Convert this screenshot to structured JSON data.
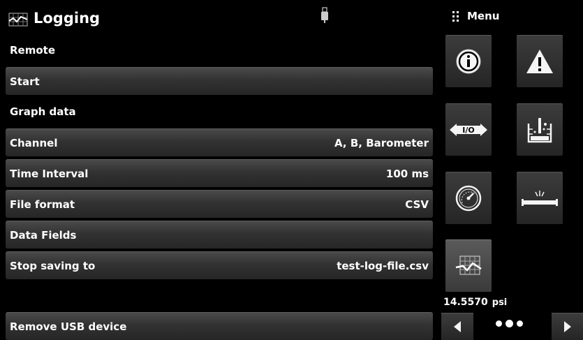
{
  "header": {
    "title": "Logging"
  },
  "rows": [
    {
      "label": "Remote",
      "value": "",
      "style": "plain"
    },
    {
      "label": "Start",
      "value": "",
      "style": "btn"
    },
    {
      "label": "Graph data",
      "value": "",
      "style": "plain"
    },
    {
      "label": "Channel",
      "value": "A, B, Barometer",
      "style": "btn"
    },
    {
      "label": "Time Interval",
      "value": "100 ms",
      "style": "btn"
    },
    {
      "label": "File format",
      "value": "CSV",
      "style": "btn"
    },
    {
      "label": "Data Fields",
      "value": "",
      "style": "btn"
    },
    {
      "label": "Stop saving to",
      "value": "test-log-file.csv",
      "style": "btn"
    },
    {
      "label": "",
      "value": "",
      "style": "plain"
    },
    {
      "label": "Remove USB device",
      "value": "",
      "style": "btn"
    }
  ],
  "menu": {
    "title": "Menu",
    "tiles": [
      {
        "icon": "info-icon"
      },
      {
        "icon": "warning-icon"
      },
      {
        "icon": "io-icon"
      },
      {
        "icon": "lab-icon"
      },
      {
        "icon": "gauge-icon"
      },
      {
        "icon": "leak-icon"
      },
      {
        "icon": "logging-icon",
        "active": true
      }
    ]
  },
  "readout": {
    "value": "14.5570",
    "unit": "psi"
  },
  "pager": {
    "total": 3
  },
  "colors": {
    "background": "#000000",
    "text": "#ffffff",
    "button": "#333333"
  }
}
